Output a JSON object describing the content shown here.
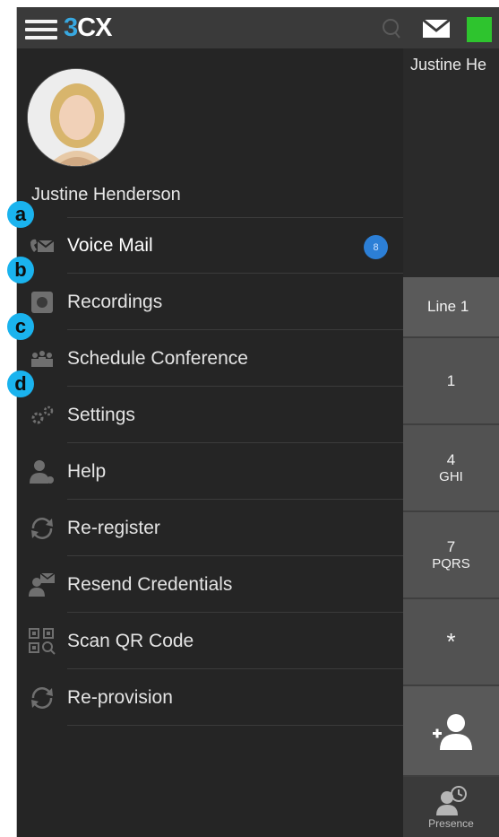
{
  "app": {
    "logo_prefix": "3",
    "logo_suffix": "CX",
    "accent_color": "#38a8e0",
    "presence_color": "#2ec42e"
  },
  "topbar": {
    "menu_icon": "hamburger-menu-icon",
    "search_icon": "search-icon",
    "mail_icon": "envelope-icon",
    "presence_icon": "presence-status-square"
  },
  "user": {
    "name": "Justine Henderson"
  },
  "menu": {
    "items": [
      {
        "label": "Voice Mail",
        "icon": "voicemail-icon",
        "badge": "8",
        "marker": "a"
      },
      {
        "label": "Recordings",
        "icon": "recordings-icon",
        "marker": "b"
      },
      {
        "label": "Schedule Conference",
        "icon": "conference-icon",
        "marker": "c"
      },
      {
        "label": "Settings",
        "icon": "settings-gears-icon",
        "marker": "d"
      },
      {
        "label": "Help",
        "icon": "help-person-icon"
      },
      {
        "label": "Re-register",
        "icon": "refresh-icon"
      },
      {
        "label": "Resend Credentials",
        "icon": "resend-credentials-icon"
      },
      {
        "label": "Scan QR Code",
        "icon": "qr-code-icon"
      },
      {
        "label": "Re-provision",
        "icon": "refresh-icon"
      }
    ]
  },
  "dialer": {
    "name": "Justine He",
    "line": "Line 1",
    "keys": [
      {
        "digit": "1",
        "letters": ""
      },
      {
        "digit": "4",
        "letters": "GHI"
      },
      {
        "digit": "7",
        "letters": "PQRS"
      },
      {
        "digit": "*",
        "letters": ""
      }
    ],
    "add_contact_icon": "add-contact-icon",
    "footer_label": "Presence",
    "footer_icon": "presence-icon"
  }
}
